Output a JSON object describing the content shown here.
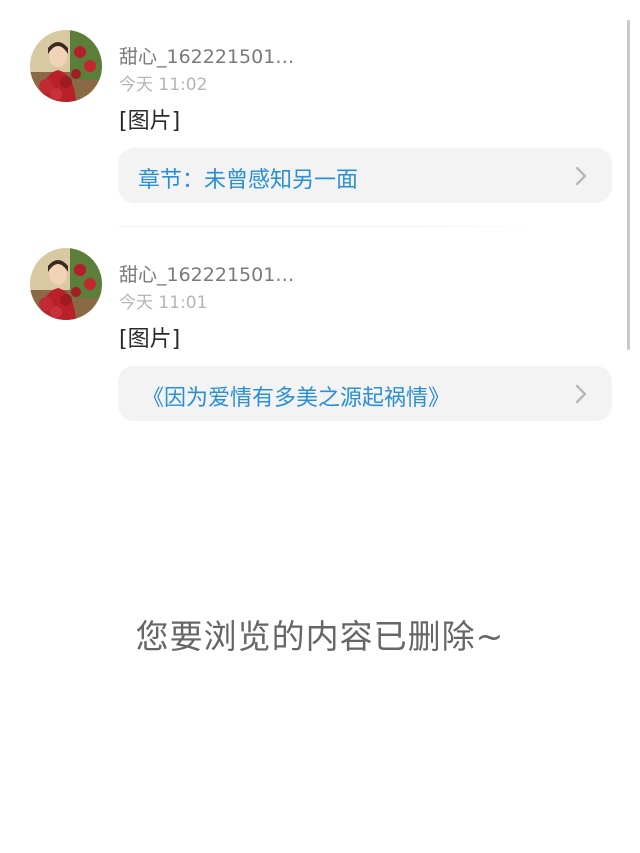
{
  "posts": [
    {
      "username": "甜心_162221501…",
      "time": "今天 11:02",
      "text": "[图片]",
      "link_label": "章节：未曾感知另一面"
    },
    {
      "username": "甜心_162221501…",
      "time": "今天 11:01",
      "text": "[图片]",
      "link_label": "《因为爱情有多美之源起祸情》"
    }
  ],
  "notice": "您要浏览的内容已删除~",
  "colors": {
    "link": "#2a8fd6",
    "card_bg": "#f3f3f4",
    "username": "#7a7a7a",
    "time": "#b5b5b5",
    "notice": "#666666"
  },
  "icons": {
    "avatar": "user-avatar-photo",
    "chevron": "chevron-right-icon"
  }
}
